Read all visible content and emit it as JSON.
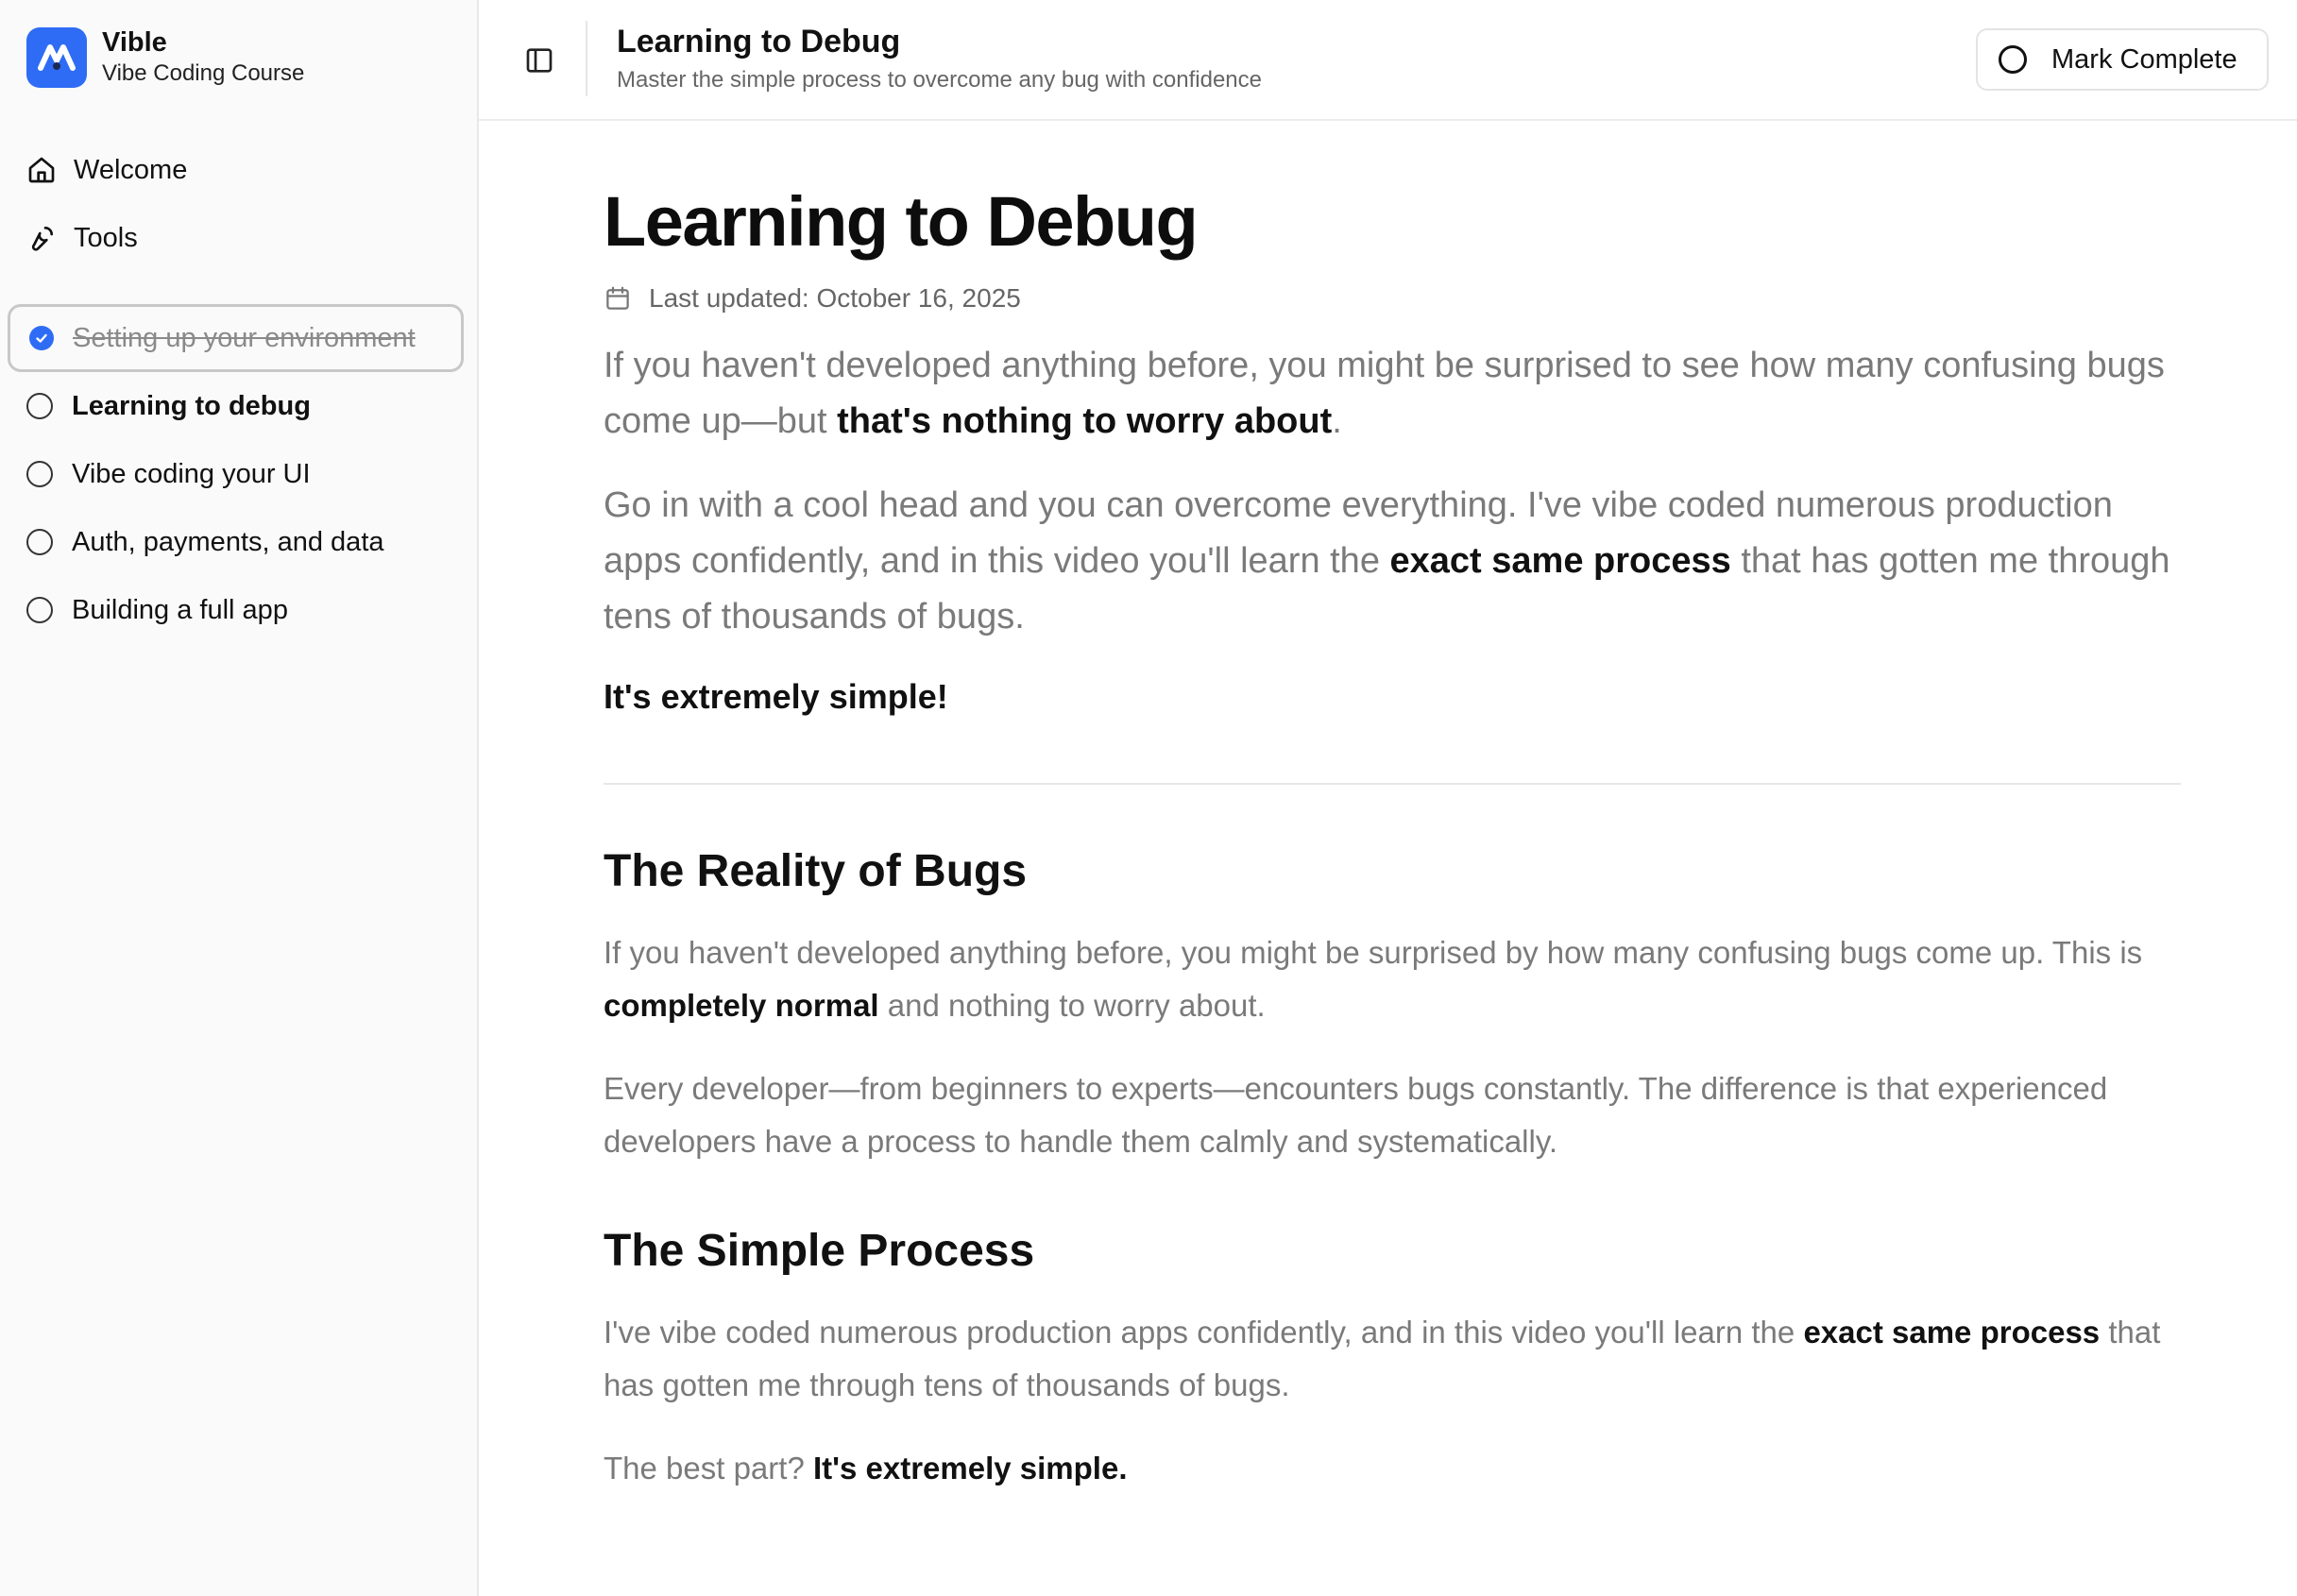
{
  "brand": {
    "name": "Vible",
    "subtitle": "Vibe Coding Course",
    "accent": "#2f6cf5"
  },
  "nav": [
    {
      "label": "Welcome",
      "icon": "home-icon"
    },
    {
      "label": "Tools",
      "icon": "wrench-icon"
    }
  ],
  "lessons": [
    {
      "label": "Setting up your environment",
      "status": "completed"
    },
    {
      "label": "Learning to debug",
      "status": "current"
    },
    {
      "label": "Vibe coding your UI",
      "status": "incomplete"
    },
    {
      "label": "Auth, payments, and data",
      "status": "incomplete"
    },
    {
      "label": "Building a full app",
      "status": "incomplete"
    }
  ],
  "header": {
    "title": "Learning to Debug",
    "subtitle": "Master the simple process to overcome any bug with confidence",
    "mark_complete": "Mark Complete"
  },
  "article": {
    "title": "Learning to Debug",
    "updated": "Last updated: October 16, 2025",
    "lead1_a": "If you haven't developed anything before, you might be surprised to see how many confusing bugs come up—but ",
    "lead1_b": "that's nothing to worry about",
    "lead1_c": ".",
    "lead2_a": "Go in with a cool head and you can overcome everything. I've vibe coded numerous production apps confidently, and in this video you'll learn the ",
    "lead2_b": "exact same process",
    "lead2_c": " that has gotten me through tens of thousands of bugs.",
    "simple": "It's extremely simple!",
    "section1": {
      "heading": "The Reality of Bugs",
      "p1_a": "If you haven't developed anything before, you might be surprised by how many confusing bugs come up. This is ",
      "p1_b": "completely normal",
      "p1_c": " and nothing to worry about.",
      "p2": "Every developer—from beginners to experts—encounters bugs constantly. The difference is that experienced developers have a process to handle them calmly and systematically."
    },
    "section2": {
      "heading": "The Simple Process",
      "p1_a": "I've vibe coded numerous production apps confidently, and in this video you'll learn the ",
      "p1_b": "exact same process",
      "p1_c": " that has gotten me through tens of thousands of bugs.",
      "p2_a": "The best part? ",
      "p2_b": "It's extremely simple."
    }
  }
}
